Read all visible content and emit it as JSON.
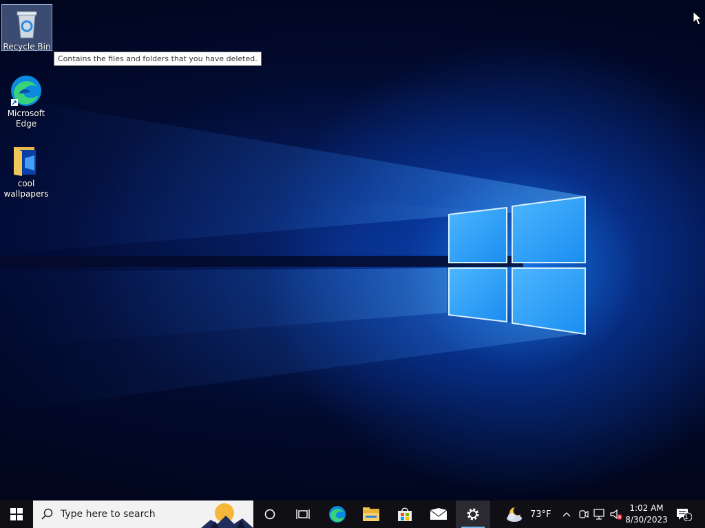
{
  "desktop": {
    "icons": [
      {
        "label": "Recycle Bin"
      },
      {
        "label": "Microsoft\nEdge"
      },
      {
        "label": "cool\nwallpapers"
      }
    ],
    "tooltip": "Contains the files and folders that you have deleted."
  },
  "taskbar": {
    "search_placeholder": "Type here to search",
    "weather_temp": "73°F",
    "time": "1:02 AM",
    "date": "8/30/2023",
    "notification_count": "1",
    "pinned": [
      "cortana-icon",
      "task-view-icon",
      "edge-icon",
      "file-explorer-icon",
      "store-icon",
      "mail-icon",
      "settings-icon"
    ],
    "accent": "#76b9ed"
  }
}
